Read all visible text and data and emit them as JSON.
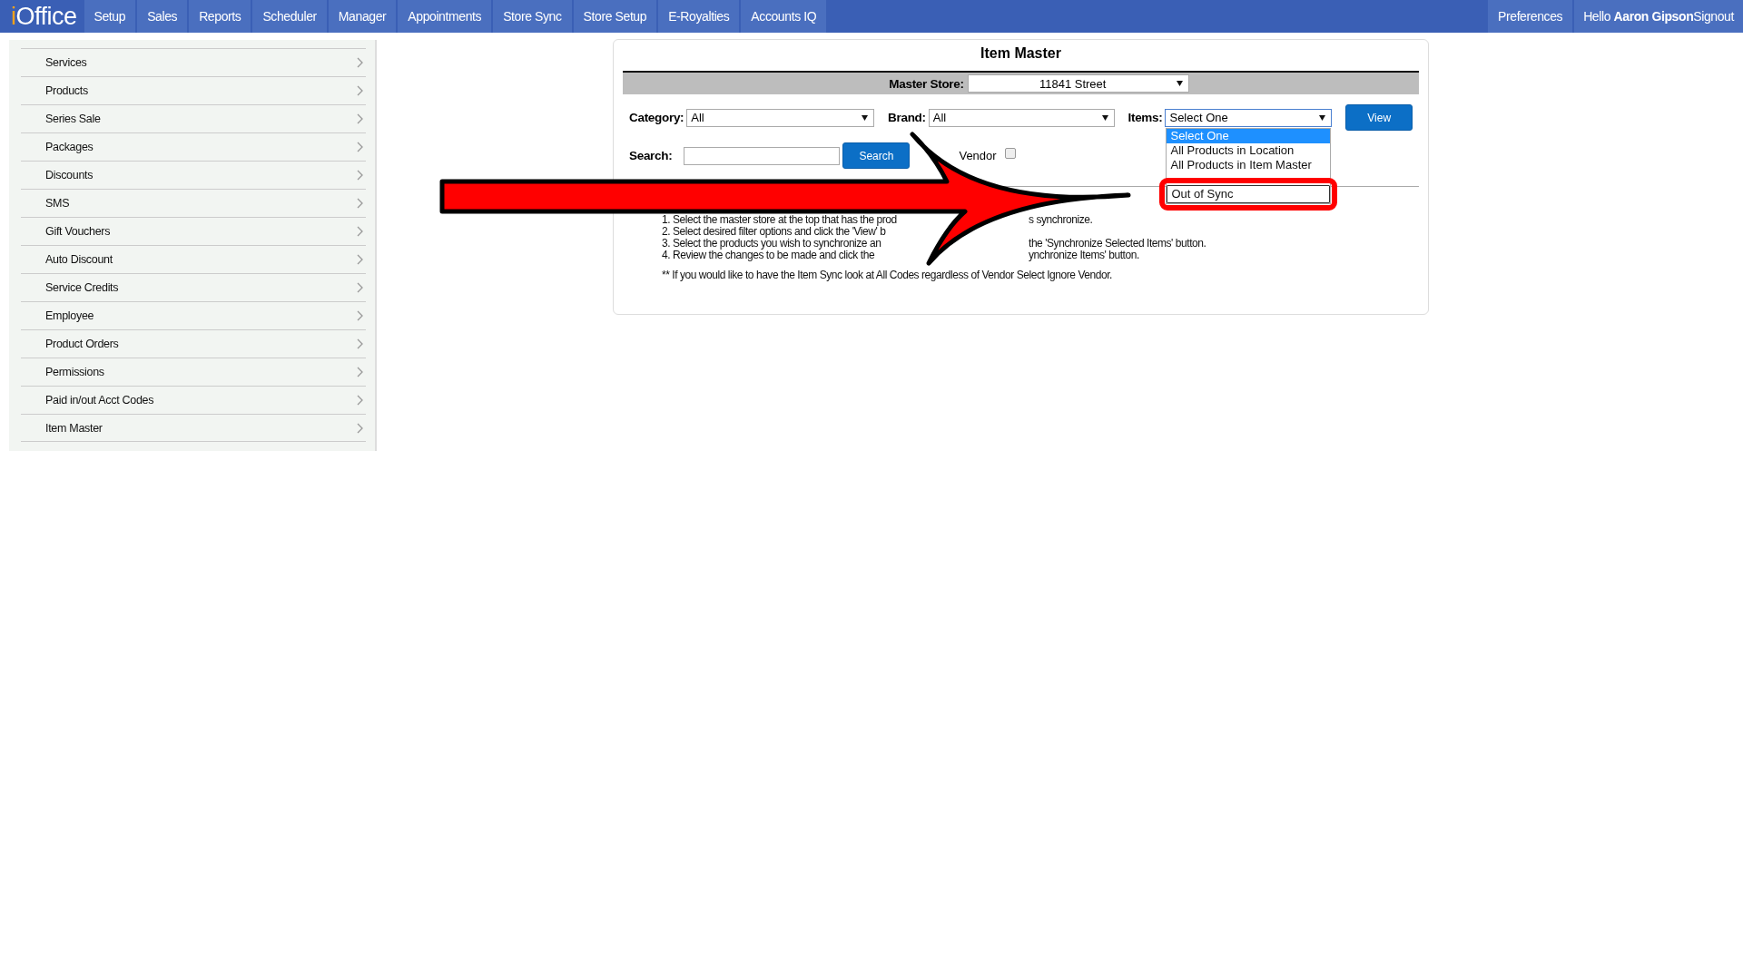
{
  "logo": {
    "prefix": "i",
    "rest": "Office"
  },
  "nav": [
    {
      "label": "Setup"
    },
    {
      "label": "Sales"
    },
    {
      "label": "Reports"
    },
    {
      "label": "Scheduler"
    },
    {
      "label": "Manager"
    },
    {
      "label": "Appointments"
    },
    {
      "label": "Store Sync"
    },
    {
      "label": "Store Setup"
    },
    {
      "label": "E-Royalties"
    },
    {
      "label": "Accounts IQ"
    }
  ],
  "user_menu": {
    "preferences": "Preferences",
    "greeting": "Hello **Aaron Gipson**",
    "signout": "Signout"
  },
  "sidebar": {
    "items": [
      {
        "label": "Services"
      },
      {
        "label": "Products"
      },
      {
        "label": "Series Sale"
      },
      {
        "label": "Packages"
      },
      {
        "label": "Discounts"
      },
      {
        "label": "SMS"
      },
      {
        "label": "Gift Vouchers"
      },
      {
        "label": "Auto Discount"
      },
      {
        "label": "Service Credits"
      },
      {
        "label": "Employee"
      },
      {
        "label": "Product Orders"
      },
      {
        "label": "Permissions"
      },
      {
        "label": "Paid in/out Acct Codes"
      },
      {
        "label": "Item Master"
      }
    ]
  },
  "panel": {
    "title": "Item Master",
    "master_store": {
      "label": "Master Store:",
      "value": "11841 Street"
    },
    "category": {
      "label": "Category:",
      "value": "All"
    },
    "brand": {
      "label": "Brand:",
      "value": "All"
    },
    "items": {
      "label": "Items:",
      "value": "Select One",
      "expanded": true,
      "options": [
        {
          "label": "Select One",
          "selected": true,
          "highlighted": false
        },
        {
          "label": "All Products in Location",
          "selected": false,
          "highlighted": false
        },
        {
          "label": "All Products in Item Master",
          "selected": false,
          "highlighted": false
        },
        {
          "label": "Out of Sync",
          "selected": false,
          "highlighted": true
        }
      ]
    },
    "view_button": "View",
    "search": {
      "label": "Search:",
      "button": "Search"
    },
    "vendor": {
      "label": "Vendor",
      "checked": false
    },
    "instructions": [
      {
        "left": "1. Select the master store at the top that has the prod",
        "right": "s synchronize."
      },
      {
        "left": "2. Select desired filter options and click the 'View' b"
      },
      {
        "left": "3. Select the products you wish to synchronize an",
        "right": "the 'Synchronize Selected Items' button."
      },
      {
        "left": "4. Review the changes to be made and click the",
        "right": "ynchronize Items' button."
      }
    ],
    "footnote": "** If you would like to have the Item Sync look at All Codes regardless of Vendor Select Ignore Vendor."
  }
}
